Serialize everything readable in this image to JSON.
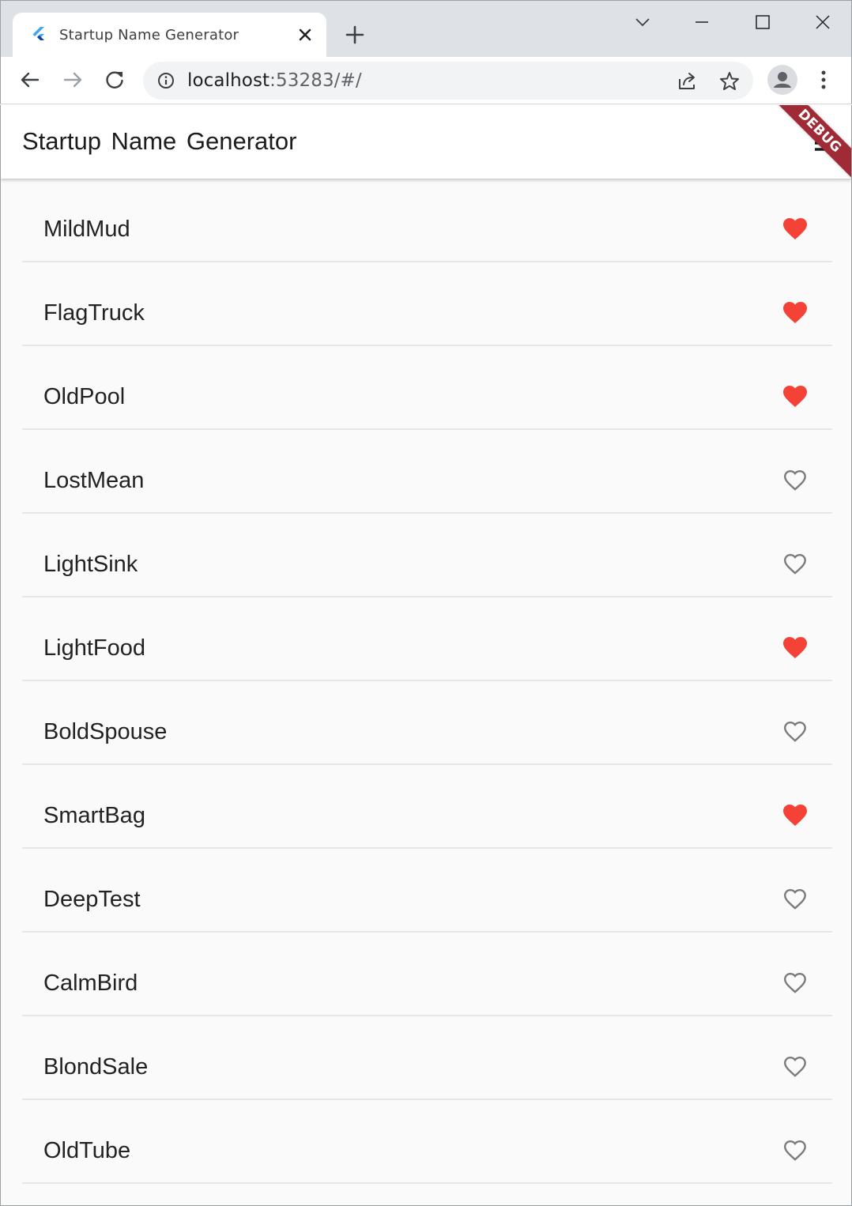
{
  "browser": {
    "tab_title": "Startup Name Generator",
    "url_host": "localhost",
    "url_rest": ":53283/#/"
  },
  "app": {
    "title": "Startup  Name Generator",
    "debug_label": "DEBUG",
    "accent_color": "#f44336",
    "items": [
      {
        "name": "MildMud",
        "saved": true
      },
      {
        "name": "FlagTruck",
        "saved": true
      },
      {
        "name": "OldPool",
        "saved": true
      },
      {
        "name": "LostMean",
        "saved": false
      },
      {
        "name": "LightSink",
        "saved": false
      },
      {
        "name": "LightFood",
        "saved": true
      },
      {
        "name": "BoldSpouse",
        "saved": false
      },
      {
        "name": "SmartBag",
        "saved": true
      },
      {
        "name": "DeepTest",
        "saved": false
      },
      {
        "name": "CalmBird",
        "saved": false
      },
      {
        "name": "BlondSale",
        "saved": false
      },
      {
        "name": "OldTube",
        "saved": false
      }
    ]
  }
}
